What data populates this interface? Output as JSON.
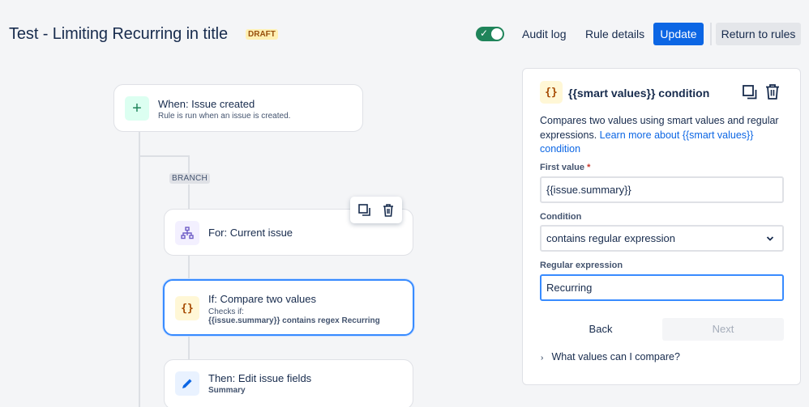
{
  "header": {
    "title": "Test - Limiting Recurring in title",
    "status_badge": "DRAFT",
    "toggle_enabled": true,
    "audit_log": "Audit log",
    "rule_details": "Rule details",
    "update": "Update",
    "return_to_rules": "Return to rules"
  },
  "flow": {
    "trigger": {
      "title": "When: Issue created",
      "subtitle": "Rule is run when an issue is created.",
      "icon": "plus-icon"
    },
    "branch_label": "BRANCH",
    "for_step": {
      "title": "For: Current issue",
      "icon": "hierarchy-icon"
    },
    "if_step": {
      "title": "If: Compare two values",
      "checks": "Checks if:",
      "detail": "{{issue.summary}} contains regex Recurring",
      "icon": "braces-icon"
    },
    "then_step": {
      "title": "Then: Edit issue fields",
      "detail": "Summary",
      "icon": "pencil-icon"
    }
  },
  "panel": {
    "icon_glyph": "{}",
    "title": "{{smart values}} condition",
    "description": "Compares two values using smart values and regular expressions.",
    "learn_more": "Learn more about {{smart values}} condition",
    "first_value_label": "First value",
    "required_marker": "*",
    "first_value": "{{issue.summary}}",
    "condition_label": "Condition",
    "condition_value": "contains regular expression",
    "regex_label": "Regular expression",
    "regex_value": "Recurring",
    "back": "Back",
    "next": "Next",
    "expander": "What values can I compare?"
  },
  "colors": {
    "primary": "#0c66e4",
    "toggle_on": "#1f845a",
    "selected_border": "#388bff",
    "draft_bg": "#fff0b3"
  }
}
